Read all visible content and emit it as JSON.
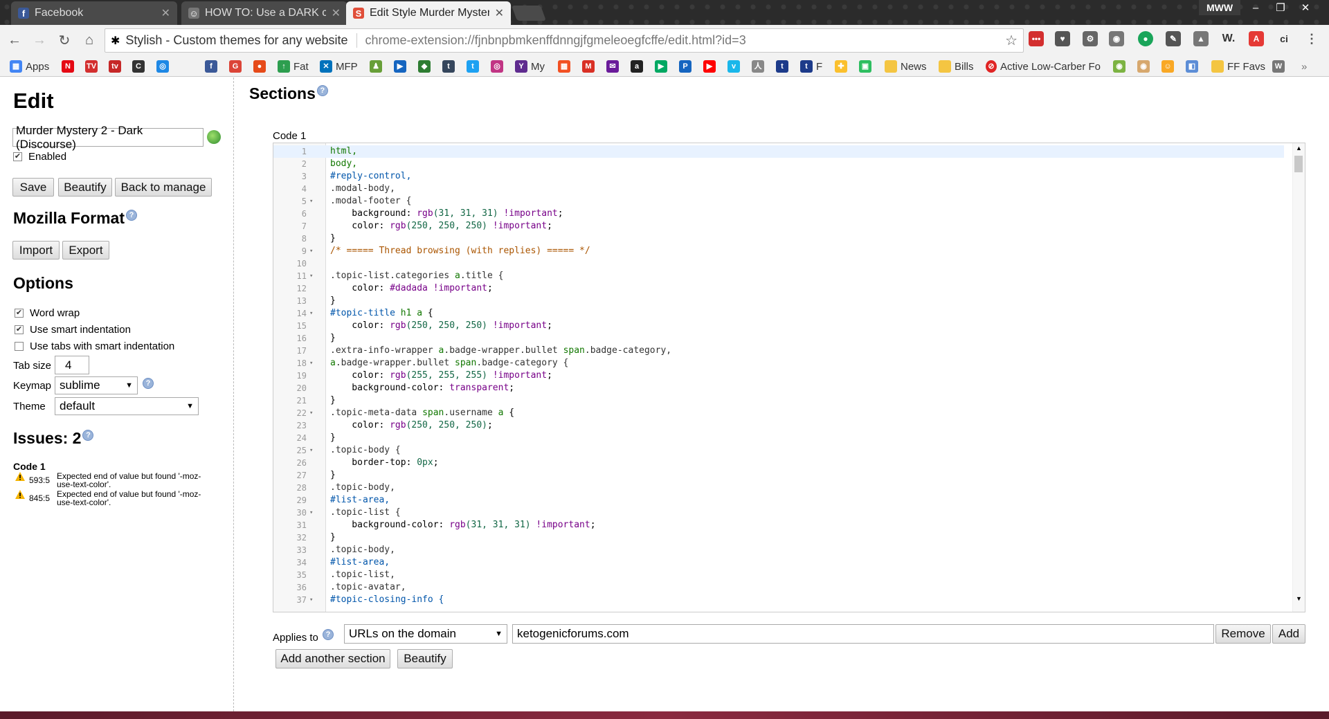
{
  "browser": {
    "tabs": [
      {
        "title": "Facebook",
        "icon": "facebook-icon",
        "color": "#3b5998",
        "glyph": "f"
      },
      {
        "title": "HOW TO: Use a DARK co",
        "icon": "person-icon",
        "color": "#777777",
        "glyph": "☺"
      },
      {
        "title": "Edit Style Murder Myster",
        "icon": "stylish-icon",
        "color": "#e04e39",
        "glyph": "S"
      }
    ],
    "profile": "MWW",
    "omnibox": {
      "chip": "Stylish - Custom themes for any website",
      "url": "chrome-extension://fjnbnpbmkenffdnngjfgmeleoegfcffe/edit.html?id=3"
    },
    "extension_labels": [
      "W.",
      "ci"
    ],
    "bookmarks": [
      {
        "label": "Apps",
        "color": "#4285f4"
      },
      {
        "label": "Fat",
        "color": "#2d9e4f"
      },
      {
        "label": "MFP",
        "color": "#0072bc"
      },
      {
        "label": "My",
        "color": "#5f2b8f"
      },
      {
        "label": "F",
        "color": "#1d3b8a"
      },
      {
        "label": "News",
        "color": "#f4c542"
      },
      {
        "label": "Bills",
        "color": "#f4c542"
      },
      {
        "label": "Active Low-Carber Fo",
        "color": "#e02424"
      },
      {
        "label": "FF Favs",
        "color": "#f4c542"
      }
    ]
  },
  "sidebar": {
    "title": "Edit",
    "style_name": "Murder Mystery 2 - Dark (Discourse)",
    "enabled_label": "Enabled",
    "buttons": {
      "save": "Save",
      "beautify": "Beautify",
      "back": "Back to manage"
    },
    "mozilla_format": {
      "title": "Mozilla Format",
      "import": "Import",
      "export": "Export"
    },
    "options": {
      "title": "Options",
      "word_wrap": "Word wrap",
      "smart_indent": "Use smart indentation",
      "tabs_smart": "Use tabs with smart indentation",
      "tab_size_label": "Tab size",
      "tab_size": "4",
      "keymap_label": "Keymap",
      "keymap": "sublime",
      "theme_label": "Theme",
      "theme": "default"
    },
    "issues": {
      "title": "Issues: 2",
      "section": "Code 1",
      "items": [
        {
          "pos": "593:5",
          "msg": "Expected end of value but found '-moz-use-text-color'."
        },
        {
          "pos": "845:5",
          "msg": "Expected end of value but found '-moz-use-text-color'."
        }
      ]
    }
  },
  "main": {
    "title": "Sections",
    "code_label": "Code 1",
    "code_lines": [
      {
        "n": "1",
        "f": "",
        "t": [
          [
            "html,",
            "tok-tag"
          ]
        ]
      },
      {
        "n": "2",
        "f": "",
        "t": [
          [
            "body,",
            "tok-tag"
          ]
        ]
      },
      {
        "n": "3",
        "f": "",
        "t": [
          [
            "#reply-control,",
            "tok-id"
          ]
        ]
      },
      {
        "n": "4",
        "f": "",
        "t": [
          [
            ".modal-body,",
            "tok-cls"
          ]
        ]
      },
      {
        "n": "5",
        "f": "▾",
        "t": [
          [
            ".modal-footer {",
            "tok-cls"
          ]
        ]
      },
      {
        "n": "6",
        "f": "",
        "t": [
          [
            "    background: ",
            "tok-prop"
          ],
          [
            "rgb",
            "tok-fn"
          ],
          [
            "(31, 31, 31) ",
            "tok-num"
          ],
          [
            "!important",
            "tok-imp"
          ],
          [
            ";",
            "tok-prop"
          ]
        ]
      },
      {
        "n": "7",
        "f": "",
        "t": [
          [
            "    color: ",
            "tok-prop"
          ],
          [
            "rgb",
            "tok-fn"
          ],
          [
            "(250, 250, 250) ",
            "tok-num"
          ],
          [
            "!important",
            "tok-imp"
          ],
          [
            ";",
            "tok-prop"
          ]
        ]
      },
      {
        "n": "8",
        "f": "",
        "t": [
          [
            "}",
            "tok-prop"
          ]
        ]
      },
      {
        "n": "9",
        "f": "▾",
        "t": [
          [
            "/* ===== Thread browsing (with replies) ===== */",
            "tok-cmt"
          ]
        ]
      },
      {
        "n": "10",
        "f": "",
        "t": [
          [
            "",
            "tok-prop"
          ]
        ]
      },
      {
        "n": "11",
        "f": "▾",
        "t": [
          [
            ".topic-list.categories ",
            "tok-cls"
          ],
          [
            "a",
            "tok-tag"
          ],
          [
            ".title {",
            "tok-cls"
          ]
        ]
      },
      {
        "n": "12",
        "f": "",
        "t": [
          [
            "    color: ",
            "tok-prop"
          ],
          [
            "#dadada",
            "tok-fn"
          ],
          [
            " ",
            "tok-prop"
          ],
          [
            "!important",
            "tok-imp"
          ],
          [
            ";",
            "tok-prop"
          ]
        ]
      },
      {
        "n": "13",
        "f": "",
        "t": [
          [
            "}",
            "tok-prop"
          ]
        ]
      },
      {
        "n": "14",
        "f": "▾",
        "t": [
          [
            "#topic-title ",
            "tok-id"
          ],
          [
            "h1 a",
            "tok-tag"
          ],
          [
            " {",
            "tok-prop"
          ]
        ]
      },
      {
        "n": "15",
        "f": "",
        "t": [
          [
            "    color: ",
            "tok-prop"
          ],
          [
            "rgb",
            "tok-fn"
          ],
          [
            "(250, 250, 250) ",
            "tok-num"
          ],
          [
            "!important",
            "tok-imp"
          ],
          [
            ";",
            "tok-prop"
          ]
        ]
      },
      {
        "n": "16",
        "f": "",
        "t": [
          [
            "}",
            "tok-prop"
          ]
        ]
      },
      {
        "n": "17",
        "f": "",
        "t": [
          [
            ".extra-info-wrapper ",
            "tok-cls"
          ],
          [
            "a",
            "tok-tag"
          ],
          [
            ".badge-wrapper.bullet ",
            "tok-cls"
          ],
          [
            "span",
            "tok-tag"
          ],
          [
            ".badge-category,",
            "tok-cls"
          ]
        ]
      },
      {
        "n": "18",
        "f": "▾",
        "t": [
          [
            "a",
            "tok-tag"
          ],
          [
            ".badge-wrapper.bullet ",
            "tok-cls"
          ],
          [
            "span",
            "tok-tag"
          ],
          [
            ".badge-category {",
            "tok-cls"
          ]
        ]
      },
      {
        "n": "19",
        "f": "",
        "t": [
          [
            "    color: ",
            "tok-prop"
          ],
          [
            "rgb",
            "tok-fn"
          ],
          [
            "(255, 255, 255) ",
            "tok-num"
          ],
          [
            "!important",
            "tok-imp"
          ],
          [
            ";",
            "tok-prop"
          ]
        ]
      },
      {
        "n": "20",
        "f": "",
        "t": [
          [
            "    background-color: ",
            "tok-prop"
          ],
          [
            "transparent",
            "tok-kw"
          ],
          [
            ";",
            "tok-prop"
          ]
        ]
      },
      {
        "n": "21",
        "f": "",
        "t": [
          [
            "}",
            "tok-prop"
          ]
        ]
      },
      {
        "n": "22",
        "f": "▾",
        "t": [
          [
            ".topic-meta-data ",
            "tok-cls"
          ],
          [
            "span",
            "tok-tag"
          ],
          [
            ".username ",
            "tok-cls"
          ],
          [
            "a",
            "tok-tag"
          ],
          [
            " {",
            "tok-prop"
          ]
        ]
      },
      {
        "n": "23",
        "f": "",
        "t": [
          [
            "    color: ",
            "tok-prop"
          ],
          [
            "rgb",
            "tok-fn"
          ],
          [
            "(250, 250, 250)",
            "tok-num"
          ],
          [
            ";",
            "tok-prop"
          ]
        ]
      },
      {
        "n": "24",
        "f": "",
        "t": [
          [
            "}",
            "tok-prop"
          ]
        ]
      },
      {
        "n": "25",
        "f": "▾",
        "t": [
          [
            ".topic-body {",
            "tok-cls"
          ]
        ]
      },
      {
        "n": "26",
        "f": "",
        "t": [
          [
            "    border-top: ",
            "tok-prop"
          ],
          [
            "0px",
            "tok-num"
          ],
          [
            ";",
            "tok-prop"
          ]
        ]
      },
      {
        "n": "27",
        "f": "",
        "t": [
          [
            "}",
            "tok-prop"
          ]
        ]
      },
      {
        "n": "28",
        "f": "",
        "t": [
          [
            ".topic-body,",
            "tok-cls"
          ]
        ]
      },
      {
        "n": "29",
        "f": "",
        "t": [
          [
            "#list-area,",
            "tok-id"
          ]
        ]
      },
      {
        "n": "30",
        "f": "▾",
        "t": [
          [
            ".topic-list {",
            "tok-cls"
          ]
        ]
      },
      {
        "n": "31",
        "f": "",
        "t": [
          [
            "    background-color: ",
            "tok-prop"
          ],
          [
            "rgb",
            "tok-fn"
          ],
          [
            "(31, 31, 31) ",
            "tok-num"
          ],
          [
            "!important",
            "tok-imp"
          ],
          [
            ";",
            "tok-prop"
          ]
        ]
      },
      {
        "n": "32",
        "f": "",
        "t": [
          [
            "}",
            "tok-prop"
          ]
        ]
      },
      {
        "n": "33",
        "f": "",
        "t": [
          [
            ".topic-body,",
            "tok-cls"
          ]
        ]
      },
      {
        "n": "34",
        "f": "",
        "t": [
          [
            "#list-area,",
            "tok-id"
          ]
        ]
      },
      {
        "n": "35",
        "f": "",
        "t": [
          [
            ".topic-list,",
            "tok-cls"
          ]
        ]
      },
      {
        "n": "36",
        "f": "",
        "t": [
          [
            ".topic-avatar,",
            "tok-cls"
          ]
        ]
      },
      {
        "n": "37",
        "f": "▾",
        "t": [
          [
            "#topic-closing-info {",
            "tok-id"
          ]
        ]
      }
    ],
    "applies_to_label": "Applies to",
    "applies_type": "URLs on the domain",
    "applies_value": "ketogenicforums.com",
    "remove": "Remove",
    "add": "Add",
    "add_section": "Add another section",
    "beautify": "Beautify"
  }
}
